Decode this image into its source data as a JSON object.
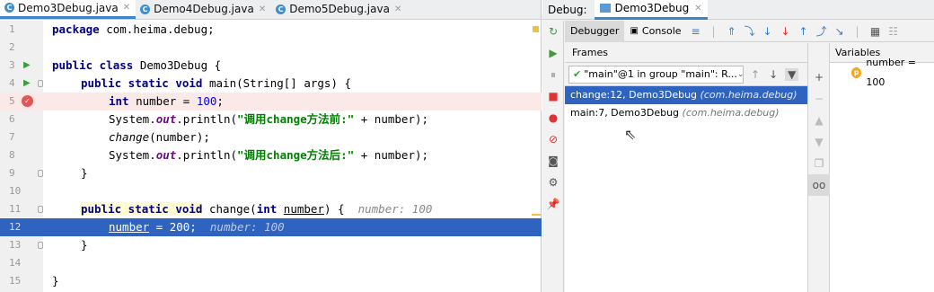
{
  "editor": {
    "tabs": [
      {
        "label": "Demo3Debug.java",
        "active": true
      },
      {
        "label": "Demo4Debug.java",
        "active": false
      },
      {
        "label": "Demo5Debug.java",
        "active": false
      }
    ],
    "line_numbers": [
      "1",
      "2",
      "3",
      "4",
      "5",
      "6",
      "7",
      "8",
      "9",
      "10",
      "11",
      "12",
      "13",
      "14",
      "15"
    ],
    "code": {
      "l1": {
        "kw": "package",
        "rest": " com.heima.debug;"
      },
      "l3": {
        "kw": "public class",
        "rest": " Demo3Debug {"
      },
      "l4": {
        "kw": "public static void",
        "rest": " main(String[] args) {"
      },
      "l5": {
        "kw": "int",
        "mid": " number = ",
        "num": "100",
        "end": ";"
      },
      "l6": {
        "a": "System.",
        "b": "out",
        "c": ".println(",
        "str": "\"调用change方法前:\"",
        "d": " + number);"
      },
      "l7": {
        "a": "change",
        "b": "(number);"
      },
      "l8": {
        "a": "System.",
        "b": "out",
        "c": ".println(",
        "str": "\"调用change方法后:\"",
        "d": " + number);"
      },
      "l9": "}",
      "l11": {
        "kw": "public static void",
        "a": " change(",
        "kw2": "int",
        "param": "number",
        "b": ") {",
        "inline": "number: 100"
      },
      "l12": {
        "var": "number",
        "a": " = 200;",
        "inline": "number: 100"
      },
      "l13": "}",
      "l15": "}"
    }
  },
  "debug": {
    "label": "Debug:",
    "session": "Demo3Debug",
    "toolbar": {
      "debugger": "Debugger",
      "console": "Console"
    },
    "frames": {
      "header": "Frames",
      "thread": "\"main\"@1 in group \"main\": R...",
      "items": [
        {
          "method": "change:12, Demo3Debug",
          "pkg": "(com.heima.debug)",
          "selected": true
        },
        {
          "method": "main:7, Demo3Debug",
          "pkg": "(com.heima.debug)",
          "selected": false
        }
      ]
    },
    "variables": {
      "header": "Variables",
      "items": [
        {
          "name": "number = 100"
        }
      ]
    }
  },
  "colors": {
    "current_line": "#2e64c0",
    "breakpoint_line": "#fbe9e7",
    "keyword": "#000080",
    "string": "#008000",
    "number": "#0000ff"
  }
}
